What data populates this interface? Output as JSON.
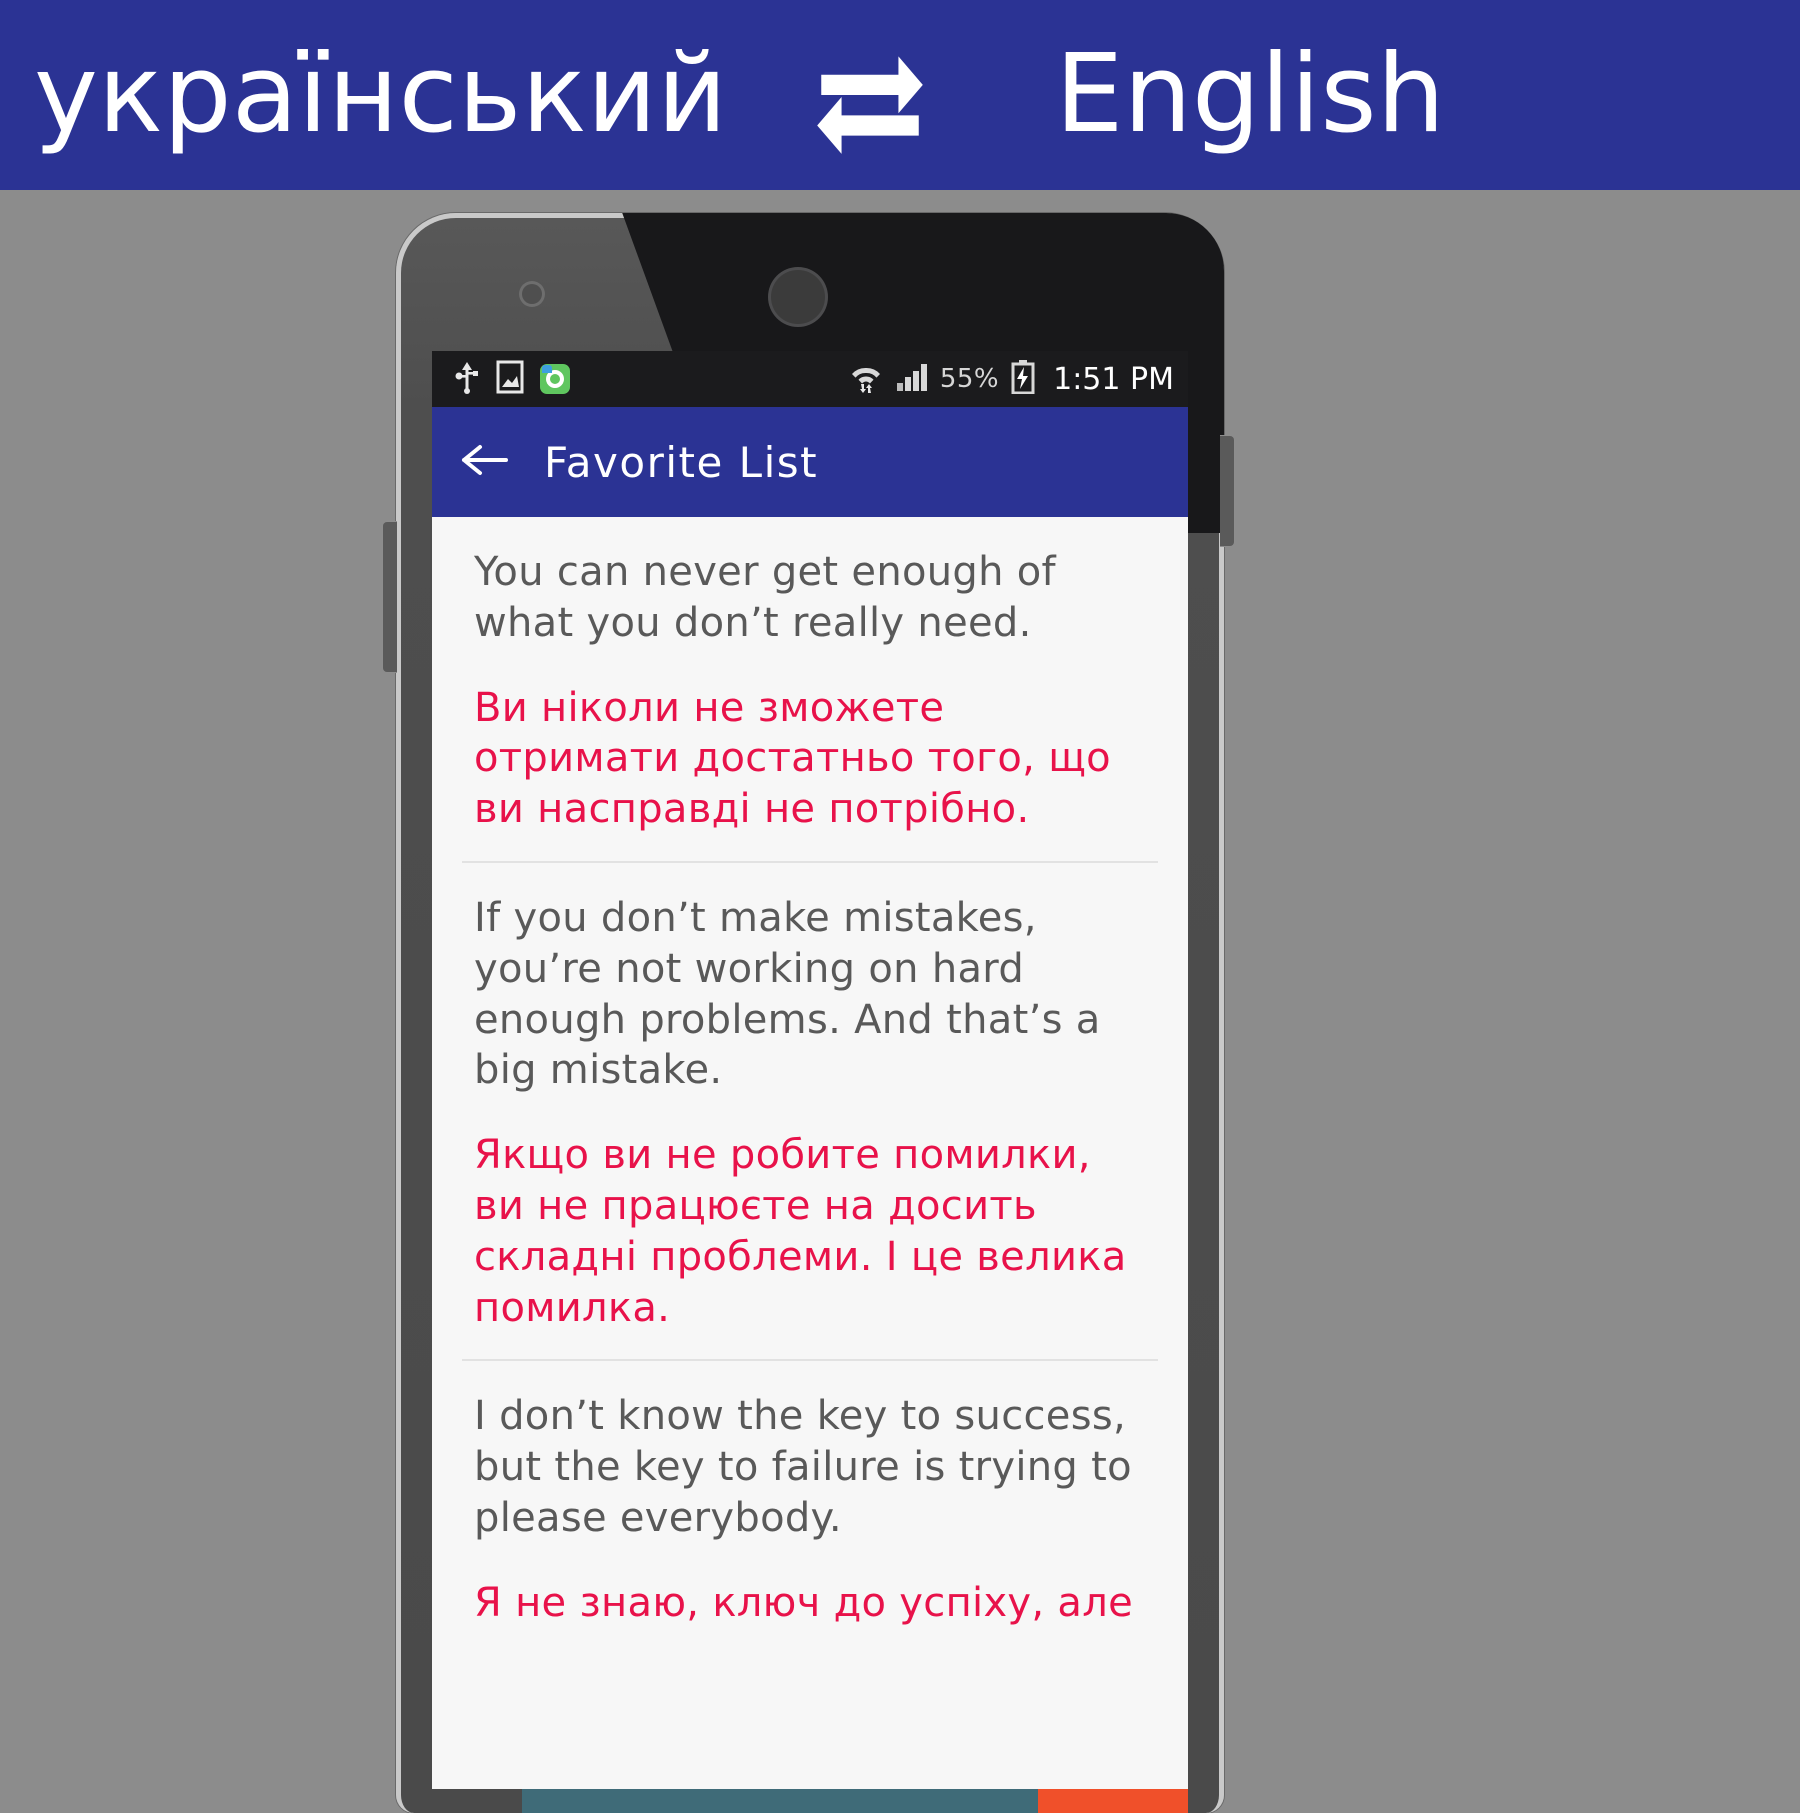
{
  "promo": {
    "source_language": "український",
    "swap_icon": "swap-repeat-icon",
    "target_language": "English",
    "banner_color": "#2b3394"
  },
  "phone": {
    "speaker_icon": "speaker-grill-icon",
    "camera_icon": "front-camera-icon",
    "power_button": "power-button",
    "volume_button": "volume-button"
  },
  "status_bar": {
    "icons_left": [
      "usb-icon",
      "screenshot-icon",
      "screen-recorder-icon"
    ],
    "icons_right": [
      "wifi-icon",
      "cellular-signal-icon"
    ],
    "battery_percent": "55%",
    "battery_icon": "battery-charging-icon",
    "time": "1:51 PM"
  },
  "app_bar": {
    "back_icon": "back-arrow-icon",
    "title": "Favorite List",
    "color": "#2b3394"
  },
  "list": {
    "items": [
      {
        "english": "You can never get enough of what you don’t really need.",
        "ukrainian": "Ви ніколи не зможете отримати достатньо того, що ви насправді не потрібно."
      },
      {
        "english": "If you don’t make mistakes, you’re not working on hard enough problems. And that’s a big mistake.",
        "ukrainian": "Якщо ви не робите помилки, ви не працюєте на досить складні проблеми. І це велика помилка."
      },
      {
        "english": "I don’t know the key to success, but the key to failure is trying to please everybody.",
        "ukrainian": "Я не знаю, ключ до успіху, але"
      }
    ],
    "english_color": "#595959",
    "ukrainian_color": "#e8124a"
  }
}
